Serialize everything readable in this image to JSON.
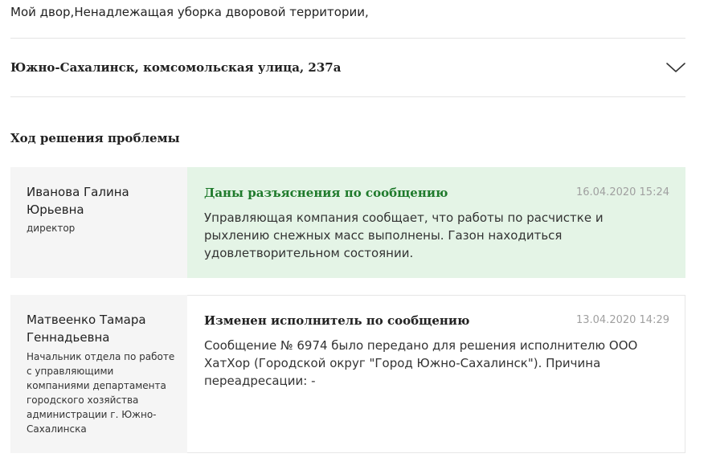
{
  "header": {
    "category": "Мой двор,Ненадлежащая уборка дворовой территории,"
  },
  "address": {
    "text": "Южно-Сахалинск, комсомольская улица, 237а",
    "toggle_icon": "chevron-down-icon"
  },
  "progress": {
    "title": "Ход решения проблемы",
    "entries": [
      {
        "author_name": "Иванова Галина Юрьевна",
        "author_role": "директор",
        "title": "Даны разъяснения по сообщению",
        "date": "16.04.2020 15:24",
        "text": "Управляющая компания сообщает, что работы по расчистке и рыхлению снежных масс выполнены. Газон находиться удовлетворительном состоянии.",
        "accent_color": "#1f7a2c",
        "background_color": "#e4f4e6"
      },
      {
        "author_name": "Матвеенко Тамара Геннадьевна",
        "author_role": "Начальник отдела по работе с управляющими компаниями департамента городского хозяйства администрации г. Южно-Сахалинска",
        "title": "Изменен исполнитель по сообщению",
        "date": "13.04.2020 14:29",
        "text": "Сообщение № 6974 было передано для решения исполнителю ООО ХатХор (Городской округ \"Город Южно-Сахалинск\"). Причина переадресации: -",
        "accent_color": "#222222",
        "background_color": "#ffffff"
      }
    ]
  }
}
